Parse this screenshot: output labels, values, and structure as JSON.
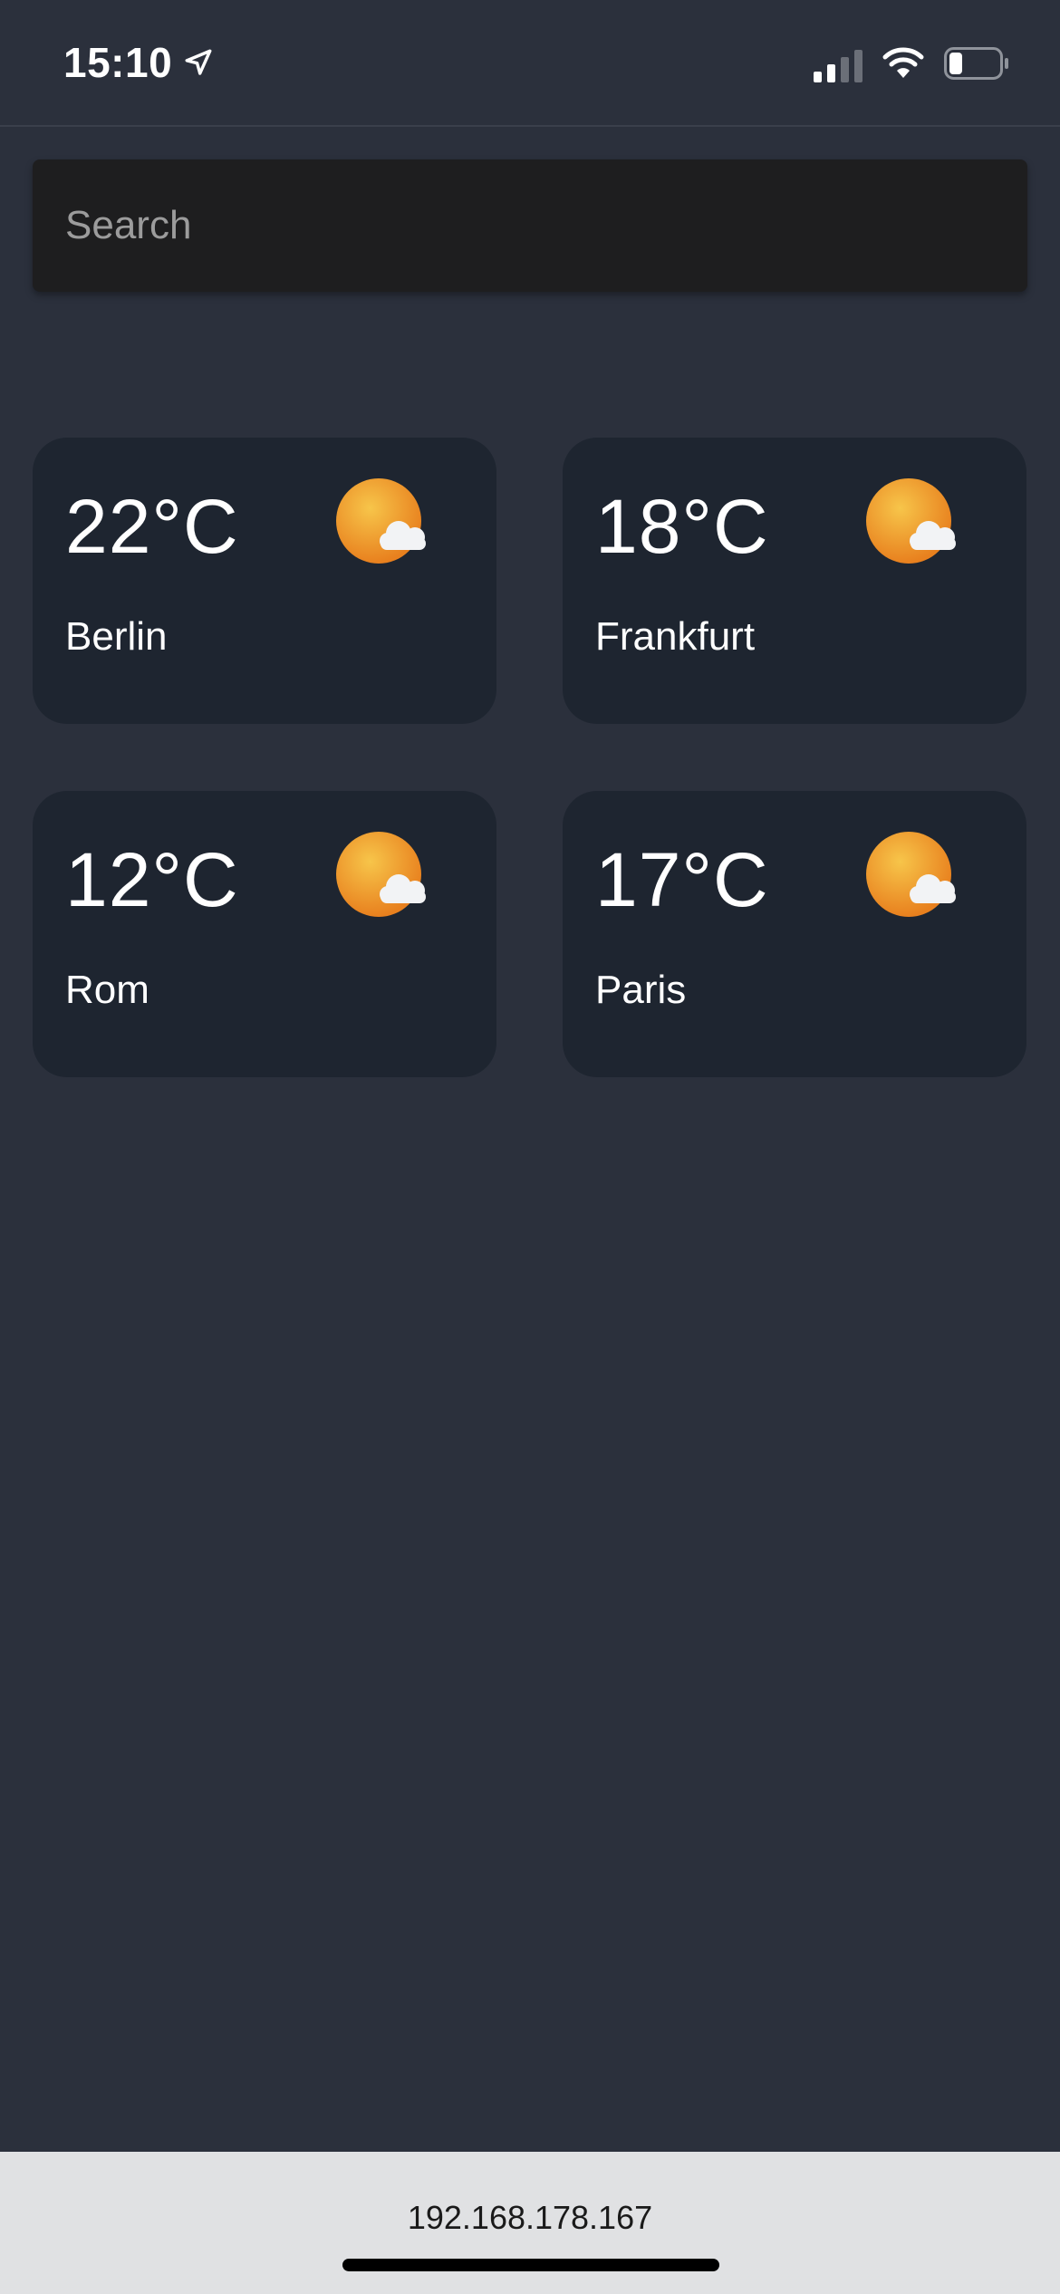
{
  "status_bar": {
    "time": "15:10",
    "location_icon": "location-arrow-icon",
    "signal_icon": "cellular-signal-icon",
    "wifi_icon": "wifi-icon",
    "battery_icon": "battery-icon",
    "signal_bars_active": 2,
    "signal_bars_total": 4,
    "battery_level": 0.25
  },
  "search": {
    "placeholder": "Search",
    "value": ""
  },
  "cities": [
    {
      "temp": "22°C",
      "name": "Berlin",
      "icon": "partly-cloudy-icon"
    },
    {
      "temp": "18°C",
      "name": "Frankfurt",
      "icon": "partly-cloudy-icon"
    },
    {
      "temp": "12°C",
      "name": "Rom",
      "icon": "partly-cloudy-icon"
    },
    {
      "temp": "17°C",
      "name": "Paris",
      "icon": "partly-cloudy-icon"
    }
  ],
  "browser": {
    "url": "192.168.178.167"
  },
  "colors": {
    "background": "#2b303c",
    "card": "#1e2530",
    "search_field": "#1e1e1f",
    "sun": "#f0a028",
    "bottom_bar": "#e0e1e3"
  }
}
